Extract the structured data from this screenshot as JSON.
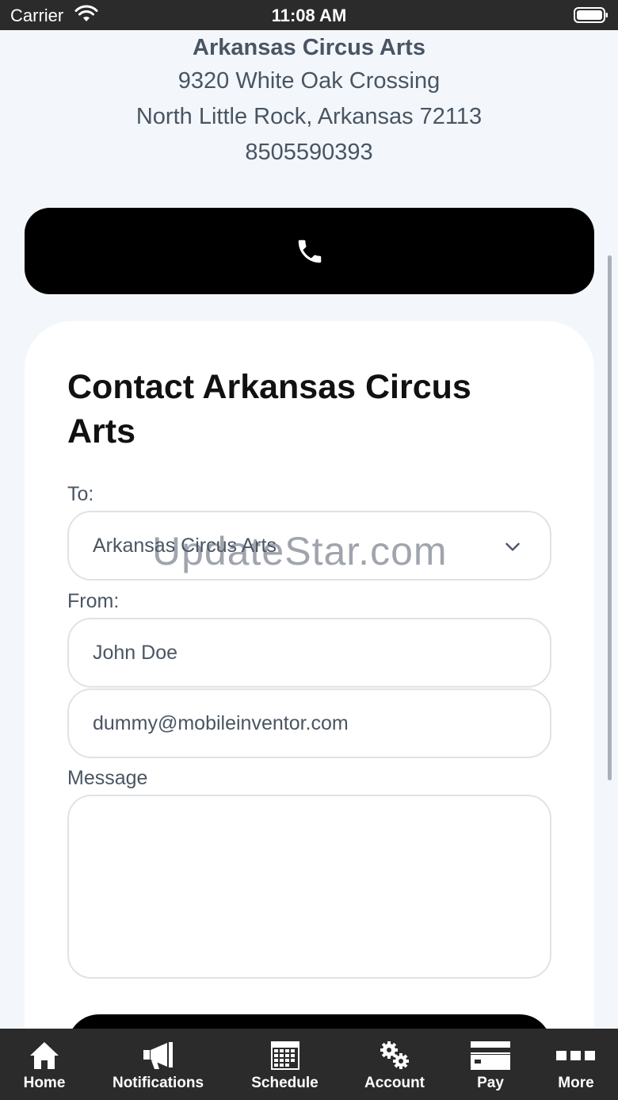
{
  "status_bar": {
    "carrier": "Carrier",
    "time": "11:08 AM"
  },
  "business": {
    "name": "Arkansas Circus Arts",
    "street": "9320 White Oak Crossing",
    "city_line": "North Little Rock, Arkansas 72113",
    "phone": "8505590393"
  },
  "contact_form": {
    "title": "Contact Arkansas Circus Arts",
    "to_label": "To:",
    "to_value": "Arkansas Circus Arts",
    "from_label": "From:",
    "name_value": "John Doe",
    "email_value": "dummy@mobileinventor.com",
    "message_label": "Message",
    "message_value": ""
  },
  "watermark": "UpdateStar.com",
  "tab_bar": {
    "items": [
      {
        "label": "Home",
        "icon": "home-icon"
      },
      {
        "label": "Notifications",
        "icon": "megaphone-icon"
      },
      {
        "label": "Schedule",
        "icon": "calendar-icon"
      },
      {
        "label": "Account",
        "icon": "gears-icon"
      },
      {
        "label": "Pay",
        "icon": "credit-card-icon"
      },
      {
        "label": "More",
        "icon": "more-icon"
      }
    ]
  },
  "colors": {
    "background": "#f3f7fb",
    "bar": "#2b2b2b",
    "button": "#000000",
    "muted_text": "#4a5563"
  }
}
